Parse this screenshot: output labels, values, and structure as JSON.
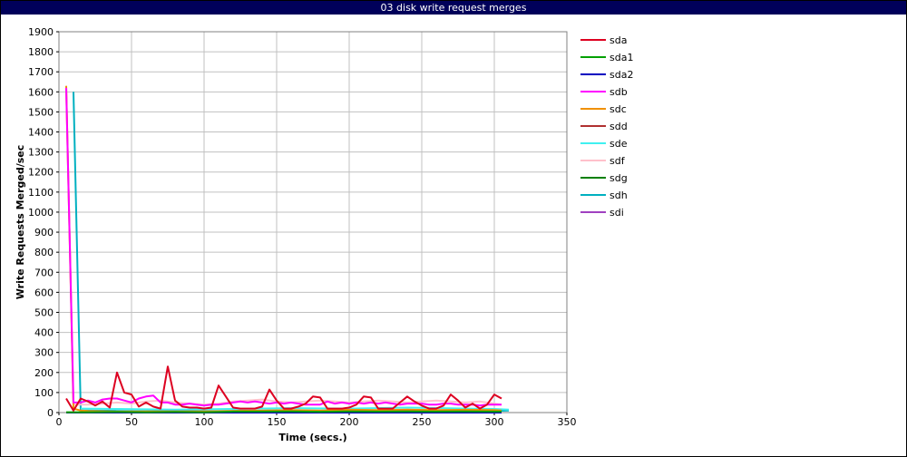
{
  "window": {
    "title": "03 disk write request merges",
    "title_bg": "#00005a",
    "title_fg": "#ffffff"
  },
  "chart_data": {
    "type": "line",
    "title": "03 disk write request merges",
    "xlabel": "Time (secs.)",
    "ylabel": "Write Requests Merged/sec",
    "xlim": [
      0,
      350
    ],
    "ylim": [
      0,
      1900
    ],
    "x_ticks": [
      0,
      50,
      100,
      150,
      200,
      250,
      300,
      350
    ],
    "y_ticks": [
      0,
      100,
      200,
      300,
      400,
      500,
      600,
      700,
      800,
      900,
      1000,
      1100,
      1200,
      1300,
      1400,
      1500,
      1600,
      1700,
      1800,
      1900
    ],
    "grid": true,
    "legend_position": "right",
    "series": [
      {
        "name": "sda",
        "color": "#dd0020",
        "x": [
          5,
          10,
          15,
          20,
          25,
          30,
          35,
          40,
          45,
          50,
          55,
          60,
          65,
          70,
          75,
          80,
          85,
          90,
          95,
          100,
          105,
          110,
          115,
          120,
          125,
          130,
          135,
          140,
          145,
          150,
          155,
          160,
          165,
          170,
          175,
          180,
          185,
          190,
          195,
          200,
          205,
          210,
          215,
          220,
          225,
          230,
          235,
          240,
          245,
          250,
          255,
          260,
          265,
          270,
          275,
          280,
          285,
          290,
          295,
          300,
          305
        ],
        "y": [
          70,
          10,
          70,
          55,
          35,
          55,
          25,
          200,
          100,
          90,
          30,
          50,
          30,
          20,
          230,
          60,
          30,
          25,
          25,
          20,
          25,
          135,
          80,
          25,
          20,
          20,
          20,
          30,
          115,
          60,
          20,
          20,
          30,
          45,
          80,
          75,
          20,
          20,
          20,
          25,
          40,
          80,
          75,
          20,
          20,
          20,
          50,
          80,
          55,
          35,
          20,
          20,
          35,
          90,
          60,
          25,
          45,
          20,
          40,
          90,
          70
        ]
      },
      {
        "name": "sda1",
        "color": "#00a000",
        "x": [
          5,
          20,
          40,
          60,
          80,
          100,
          120,
          140,
          160,
          180,
          200,
          220,
          240,
          260,
          280,
          300,
          305
        ],
        "y": [
          2,
          2,
          3,
          2,
          3,
          2,
          5,
          5,
          6,
          4,
          6,
          5,
          6,
          5,
          6,
          5,
          5
        ]
      },
      {
        "name": "sda2",
        "color": "#0000c0",
        "x": [
          5,
          40,
          80,
          120,
          160,
          200,
          240,
          280,
          305
        ],
        "y": [
          0,
          0,
          0,
          0,
          0,
          0,
          0,
          0,
          0
        ]
      },
      {
        "name": "sdb",
        "color": "#ff00ff",
        "x": [
          5,
          10,
          15,
          20,
          25,
          30,
          35,
          40,
          45,
          50,
          55,
          60,
          65,
          70,
          75,
          80,
          85,
          90,
          95,
          100,
          105,
          110,
          115,
          120,
          125,
          130,
          135,
          140,
          145,
          150,
          155,
          160,
          165,
          170,
          175,
          180,
          185,
          190,
          195,
          200,
          205,
          210,
          215,
          220,
          225,
          230,
          235,
          240,
          245,
          250,
          255,
          260,
          265,
          270,
          275,
          280,
          285,
          290,
          295,
          300,
          305
        ],
        "y": [
          1620,
          50,
          50,
          60,
          50,
          65,
          70,
          70,
          60,
          50,
          70,
          80,
          85,
          50,
          50,
          40,
          40,
          45,
          40,
          35,
          40,
          40,
          45,
          50,
          55,
          50,
          55,
          50,
          45,
          50,
          45,
          50,
          45,
          40,
          40,
          40,
          55,
          45,
          50,
          45,
          50,
          45,
          50,
          45,
          50,
          45,
          40,
          45,
          45,
          45,
          40,
          40,
          45,
          45,
          40,
          40,
          40,
          35,
          40,
          40,
          40
        ]
      },
      {
        "name": "sdc",
        "color": "#f09000",
        "x": [
          5,
          10,
          15,
          20,
          40,
          60,
          80,
          100,
          120,
          140,
          160,
          180,
          200,
          220,
          240,
          260,
          280,
          300,
          305
        ],
        "y": [
          1630,
          20,
          10,
          8,
          5,
          6,
          5,
          6,
          8,
          10,
          12,
          10,
          14,
          12,
          15,
          12,
          14,
          12,
          10
        ]
      },
      {
        "name": "sdd",
        "color": "#b03030",
        "x": [
          15,
          40,
          80,
          120,
          160,
          200,
          240,
          280,
          305
        ],
        "y": [
          5,
          4,
          6,
          5,
          7,
          6,
          8,
          7,
          6
        ]
      },
      {
        "name": "sde",
        "color": "#40f0f0",
        "x": [
          15,
          40,
          80,
          120,
          160,
          200,
          240,
          280,
          300,
          310
        ],
        "y": [
          20,
          18,
          15,
          18,
          22,
          20,
          25,
          20,
          18,
          15
        ]
      },
      {
        "name": "sdf",
        "color": "#ffc0cb",
        "x": [
          5,
          10,
          15,
          20,
          30,
          40,
          50,
          60,
          70,
          80,
          90,
          100,
          110,
          120,
          130,
          140,
          150,
          160,
          170,
          180,
          190,
          200,
          210,
          220,
          230,
          240,
          250,
          260,
          270,
          280,
          290,
          300,
          305
        ],
        "y": [
          1610,
          40,
          40,
          40,
          45,
          50,
          45,
          55,
          60,
          50,
          45,
          40,
          45,
          55,
          60,
          65,
          55,
          50,
          55,
          60,
          55,
          50,
          55,
          60,
          55,
          50,
          55,
          60,
          55,
          50,
          55,
          45,
          40
        ]
      },
      {
        "name": "sdg",
        "color": "#008000",
        "x": [
          15,
          40,
          80,
          120,
          160,
          200,
          240,
          280,
          305
        ],
        "y": [
          3,
          3,
          4,
          4,
          5,
          5,
          6,
          5,
          5
        ]
      },
      {
        "name": "sdh",
        "color": "#00b0c0",
        "x": [
          10,
          15,
          20,
          40,
          80,
          120,
          160,
          200,
          240,
          280,
          300,
          310
        ],
        "y": [
          1600,
          10,
          10,
          8,
          6,
          8,
          10,
          8,
          10,
          8,
          8,
          10
        ]
      },
      {
        "name": "sdi",
        "color": "#a040c0",
        "x": [
          15,
          40,
          80,
          120,
          160,
          200,
          240,
          280,
          305
        ],
        "y": [
          2,
          2,
          3,
          3,
          4,
          4,
          4,
          3,
          3
        ]
      }
    ]
  }
}
